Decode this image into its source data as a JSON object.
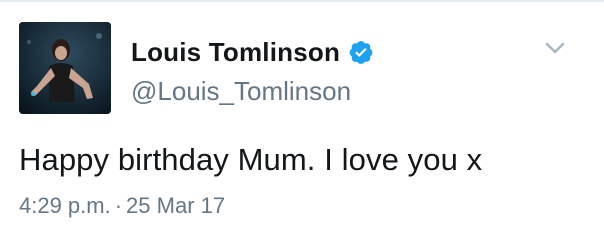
{
  "tweet": {
    "display_name": "Louis Tomlinson",
    "handle": "@Louis_Tomlinson",
    "verified": true,
    "text": "Happy birthday Mum. I love you x",
    "time": "4:29 p.m.",
    "separator": "·",
    "date": "25 Mar 17"
  },
  "icons": {
    "verified": "verified-badge-icon",
    "more": "chevron-down-icon"
  },
  "colors": {
    "verified_badge": "#1da1f2",
    "name_text": "#14171a",
    "secondary_text": "#657786",
    "chevron": "#aab8c2"
  }
}
